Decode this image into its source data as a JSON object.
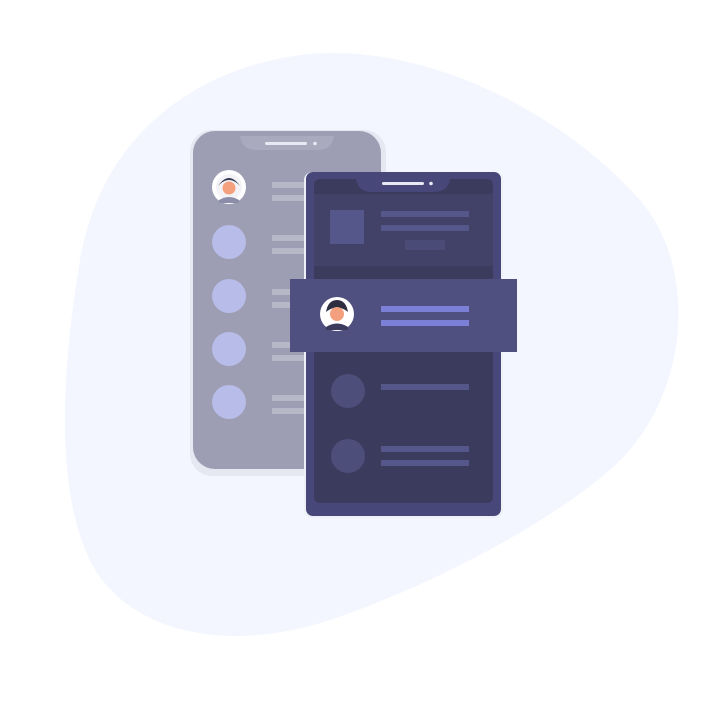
{
  "illustration": {
    "subject": "two-phones-contact-list",
    "colors": {
      "blob": "#f3f6fe",
      "back_phone": "#9d9eb3",
      "back_phone_shadow": "#e5e7f1",
      "back_avatar_dot": "#b8bce8",
      "back_line": "#b6b7c7",
      "front_phone": "#47477a",
      "front_screen": "#3b3b5e",
      "front_screen_card": "#424269",
      "front_line": "#55578a",
      "highlight_band": "#4f4f80",
      "highlight_line": "#7b7fd6",
      "skin": "#f4a07e",
      "hair": "#2f2e41"
    },
    "icons": [
      "avatar-icon",
      "speaker-notch-icon",
      "placeholder-avatar-icon",
      "placeholder-image-icon"
    ]
  }
}
